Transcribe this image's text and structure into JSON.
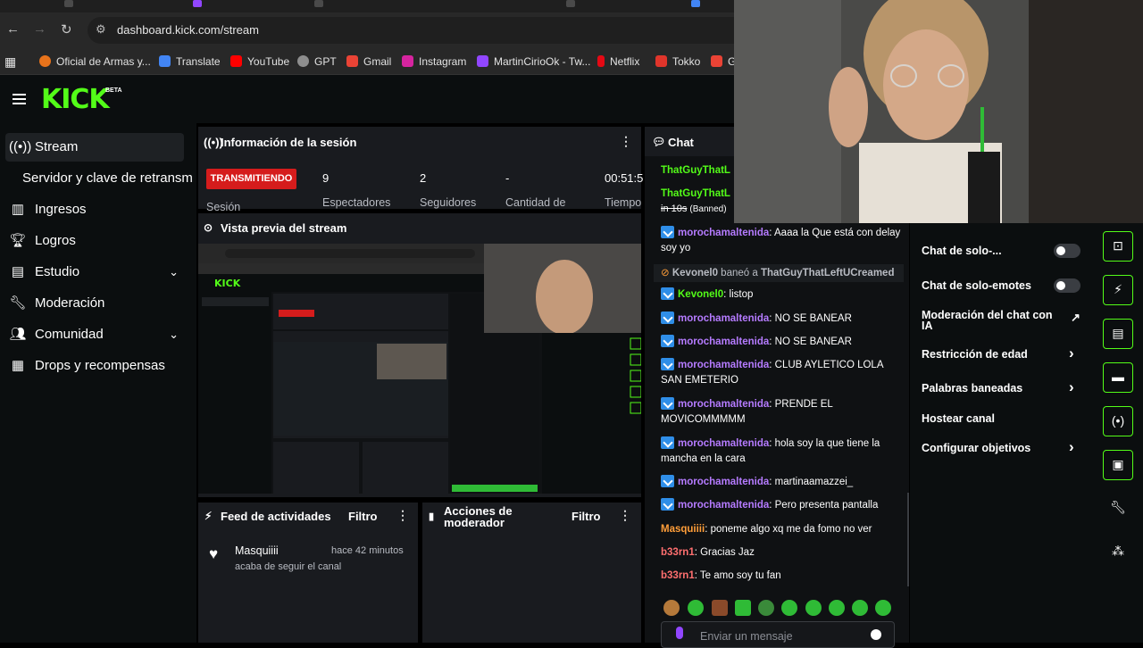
{
  "browser": {
    "url": "dashboard.kick.com/stream",
    "bookmarks": [
      {
        "label": "Oficial de Armas y...",
        "color": "#e8731b"
      },
      {
        "label": "Translate",
        "color": "#4285f4"
      },
      {
        "label": "YouTube",
        "color": "#ff0000"
      },
      {
        "label": "GPT",
        "color": "#8e8e8e"
      },
      {
        "label": "Gmail",
        "color": "#ea4335"
      },
      {
        "label": "Instagram",
        "color": "#d6249f"
      },
      {
        "label": "MartinCirioOk - Tw...",
        "color": "#9146ff"
      },
      {
        "label": "Netflix",
        "color": "#e50914"
      },
      {
        "label": "Tokko",
        "color": "#e0352b"
      },
      {
        "label": "G",
        "color": "#ea4335"
      }
    ]
  },
  "kick": {
    "logo": "KICK",
    "beta": "BETA"
  },
  "sidebar": {
    "items": [
      {
        "label": "Stream",
        "icon": "broadcast-icon"
      },
      {
        "label": "Servidor y clave de retransm",
        "icon": ""
      },
      {
        "label": "Ingresos",
        "icon": "chart-icon"
      },
      {
        "label": "Logros",
        "icon": "trophy-icon"
      },
      {
        "label": "Estudio",
        "icon": "studio-icon"
      },
      {
        "label": "Moderación",
        "icon": "wrench-icon"
      },
      {
        "label": "Comunidad",
        "icon": "community-icon"
      },
      {
        "label": "Drops y recompensas",
        "icon": "drops-icon"
      }
    ]
  },
  "session": {
    "title": "Información de la sesión",
    "status": "TRANSMITIENDO",
    "status_label": "Sesión",
    "viewers": "9",
    "viewers_label": "Espectadores",
    "followers": "2",
    "followers_label": "Seguidores",
    "amount": "-",
    "amount_label": "Cantidad de",
    "time": "00:51:5",
    "time_label": "Tiempo"
  },
  "preview": {
    "title": "Vista previa del stream"
  },
  "feed": {
    "title": "Feed de actividades",
    "filter": "Filtro",
    "user": "Masquiiii",
    "time": "hace 42 minutos",
    "action": "acaba de seguir el canal"
  },
  "moderator": {
    "title_line1": "Acciones de",
    "title_line2": "moderador",
    "filter": "Filtro"
  },
  "chat": {
    "title": "Chat",
    "placeholder": "Enviar un mensaje",
    "messages": [
      {
        "user": "ThatGuyThatL",
        "text": ""
      },
      {
        "user": "ThatGuyThatL",
        "text": ""
      },
      {
        "user": "",
        "text": "in 10s",
        "suffix": "(Banned)"
      },
      {
        "user": "morochamaltenida",
        "text": ": Aaaa la Que está con delay soy yo"
      },
      {
        "user": "Kevonel0",
        "text": " baneó a ",
        "target": "ThatGuyThatLeftUCreamed"
      },
      {
        "user": "Kevonel0",
        "text": ": listop"
      },
      {
        "user": "morochamaltenida",
        "text": ": NO SE BANEAR"
      },
      {
        "user": "morochamaltenida",
        "text": ": NO SE BANEAR"
      },
      {
        "user": "morochamaltenida",
        "text": ": CLUB AYLETICO LOLA SAN EMETERIO"
      },
      {
        "user": "morochamaltenida",
        "text": ": PRENDE EL MOVICOMMMMM"
      },
      {
        "user": "morochamaltenida",
        "text": ": hola soy la que tiene la mancha en la cara"
      },
      {
        "user": "morochamaltenida",
        "text": ": martinaamazzei_"
      },
      {
        "user": "morochamaltenida",
        "text": ": Pero presenta pantalla"
      },
      {
        "user": "Masquiiii",
        "text": ": poneme algo xq me da fomo no ver"
      },
      {
        "user": "b33rn1",
        "text": ": Gracias Jaz"
      },
      {
        "user": "b33rn1",
        "text": ": Te amo soy tu fan"
      }
    ]
  },
  "settings": {
    "items": [
      {
        "label": "Chat de solo-...",
        "control": "toggle"
      },
      {
        "label": "Chat de solo-emotes",
        "control": "toggle"
      },
      {
        "label": "Moderación del chat con",
        "label2": "IA",
        "control": "external"
      },
      {
        "label": "Restricción de edad",
        "control": "arrow"
      },
      {
        "label": "Palabras baneadas",
        "control": "arrow"
      },
      {
        "label": "Hostear canal",
        "control": "none"
      },
      {
        "label": "Configurar objetivos",
        "control": "arrow"
      }
    ]
  },
  "colors": {
    "accent": "#53fc18",
    "live": "#d51c1c",
    "mod_badge": "#2f8ee8"
  }
}
